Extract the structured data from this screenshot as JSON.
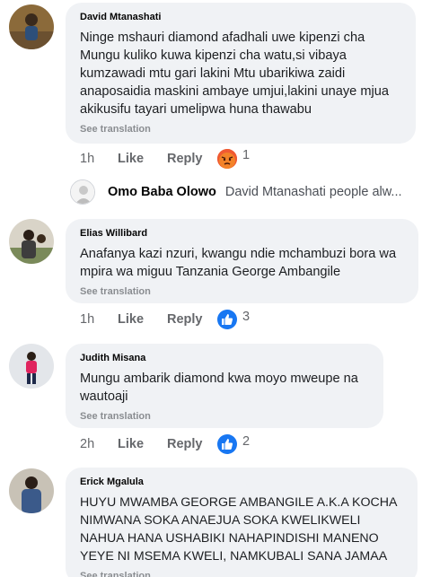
{
  "comments": [
    {
      "author": "David Mtanashati",
      "text": "Ninge mshauri diamond afadhali uwe kipenzi cha Mungu kuliko kuwa kipenzi cha watu,si vibaya kumzawadi mtu gari lakini Mtu ubarikiwa zaidi anaposaidia maskini ambaye umjui,lakini unaye mjua akikusifu tayari umelipwa huna thawabu",
      "see_translation": "See translation",
      "time": "1h",
      "like": "Like",
      "reply": "Reply",
      "reaction_icon": "angry-reaction-icon",
      "reaction_count": "1"
    },
    {
      "author": "Elias Willibard",
      "text": "Anafanya kazi nzuri, kwangu ndie mchambuzi bora wa mpira wa miguu Tanzania George Ambangile",
      "see_translation": "See translation",
      "time": "1h",
      "like": "Like",
      "reply": "Reply",
      "reaction_icon": "like-reaction-icon",
      "reaction_count": "3"
    },
    {
      "author": "Judith Misana",
      "text": "Mungu ambarik diamond kwa moyo mweupe na wautoaji",
      "see_translation": "See translation",
      "time": "2h",
      "like": "Like",
      "reply": "Reply",
      "reaction_icon": "like-reaction-icon",
      "reaction_count": "2"
    },
    {
      "author": "Erick Mgalula",
      "text": "HUYU MWAMBA GEORGE AMBANGILE A.K.A KOCHA NIMWANA SOKA ANAEJUA SOKA KWELIKWELI NAHUA HANA USHABIKI NAHAPINDISHI MANENO YEYE NI MSEMA KWELI, NAMKUBALI SANA JAMAA",
      "see_translation": "See translation"
    }
  ],
  "reply_preview": {
    "author": "Omo Baba Olowo",
    "text": "David Mtanashati people alw..."
  },
  "colors": {
    "bubble": "#f0f2f5",
    "like_blue": "#1877f2",
    "angry_orange": "#f0643c",
    "meta_gray": "#65676b"
  }
}
